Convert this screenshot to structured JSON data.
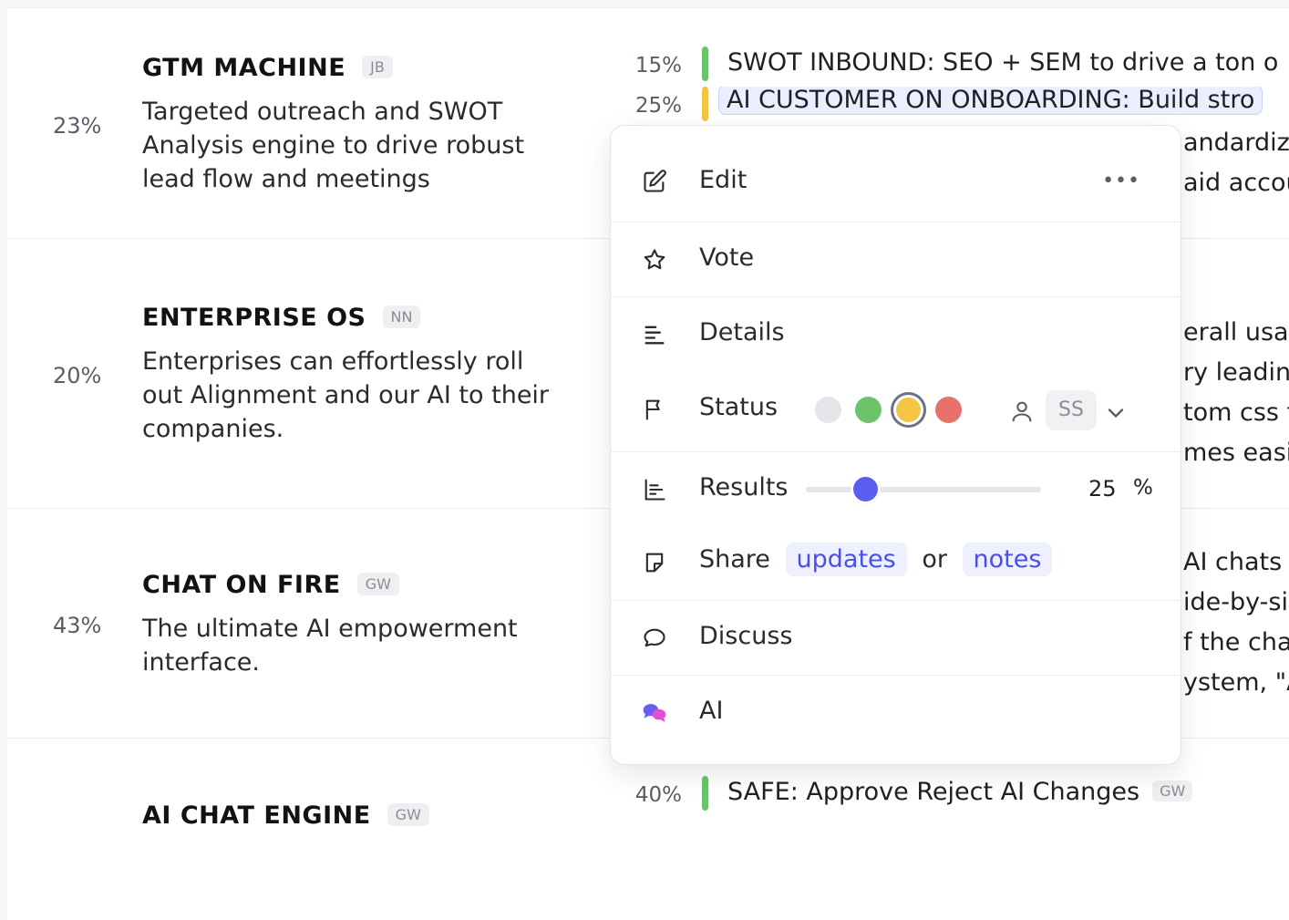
{
  "objectives": [
    {
      "pct": "23%",
      "title": "GTM MACHINE",
      "owner": "JB",
      "desc": "Targeted outreach and SWOT Analysis engine to drive robust lead flow and meetings"
    },
    {
      "pct": "20%",
      "title": "ENTERPRISE OS",
      "owner": "NN",
      "desc": "Enterprises can effortlessly roll out Alignment and our AI to their companies."
    },
    {
      "pct": "43%",
      "title": "CHAT ON FIRE",
      "owner": "GW",
      "desc": "The ultimate AI empowerment interface."
    },
    {
      "pct": "",
      "title": "AI CHAT ENGINE",
      "owner": "GW",
      "desc": ""
    }
  ],
  "key_results": [
    {
      "pct": "15%",
      "text": "SWOT INBOUND: SEO + SEM to drive a ton o",
      "color": "#6cc46a",
      "owner": ""
    },
    {
      "pct": "25%",
      "text": "AI CUSTOMER ON ONBOARDING: Build stro",
      "color": "#f4c542",
      "owner": ""
    },
    {
      "pct": "40%",
      "text": "SAFE: Approve Reject AI Changes",
      "color": "#6cc46a",
      "owner": "GW"
    }
  ],
  "background_fragments": [
    "andardizi",
    "aid accou",
    "erall usak",
    "ry leadin",
    "tom css t",
    "mes easi",
    "AI chats -",
    "ide-by-si",
    "f the cha",
    "ystem, \"A"
  ],
  "menu": {
    "edit": {
      "label": "Edit",
      "icon": "edit-pencil-icon",
      "more": "•••"
    },
    "vote": {
      "label": "Vote",
      "icon": "star-icon"
    },
    "details": {
      "label": "Details",
      "icon": "align-left-icon"
    },
    "status": {
      "label": "Status",
      "icon": "flag-icon",
      "options": [
        {
          "color": "#e5e6ea",
          "selected": false
        },
        {
          "color": "#6cc46a",
          "selected": false
        },
        {
          "color": "#f4c542",
          "selected": true
        },
        {
          "color": "#e8706a",
          "selected": false
        }
      ],
      "assignee": "SS"
    },
    "results": {
      "label": "Results",
      "icon": "bar-chart-icon",
      "value": "25",
      "unit": "%",
      "progress": 0.25
    },
    "share": {
      "label": "Share",
      "icon": "sticky-note-icon",
      "updates": "updates",
      "or": "or",
      "notes": "notes"
    },
    "discuss": {
      "label": "Discuss",
      "icon": "chat-bubble-icon"
    },
    "ai": {
      "label": "AI",
      "icon": "ai-chat-icon"
    }
  }
}
